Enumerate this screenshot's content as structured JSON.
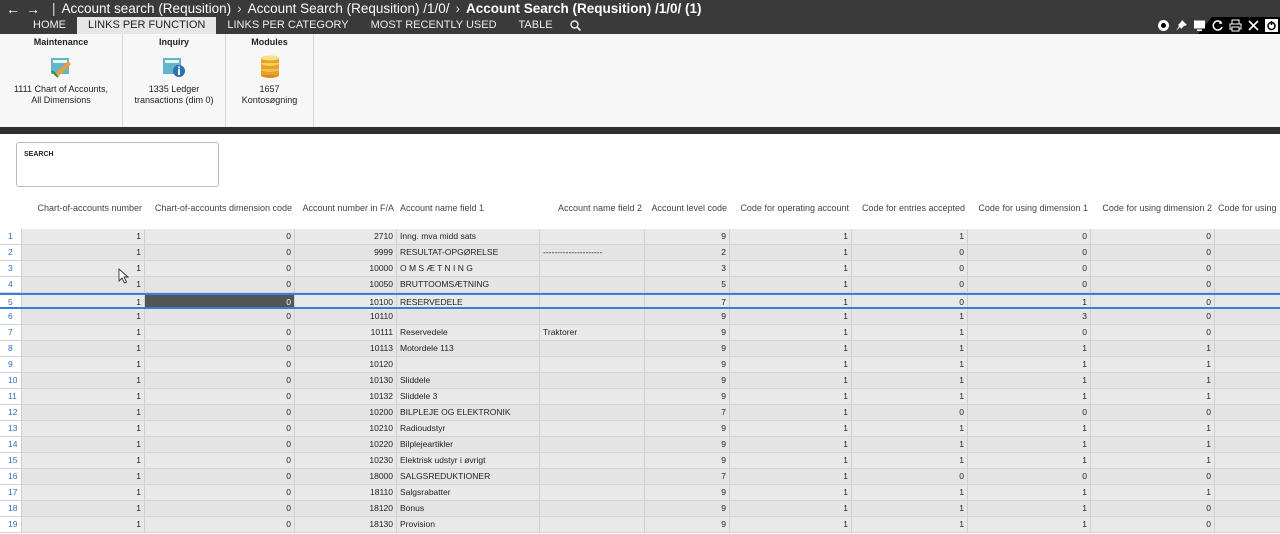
{
  "breadcrumb": {
    "back": "←",
    "forward": "→",
    "items": [
      "Account search (Requsition)",
      "Account Search (Requsition) /1/0/"
    ],
    "current": "Account Search (Requsition) /1/0/ (1)"
  },
  "tabs": [
    "HOME",
    "LINKS PER FUNCTION",
    "LINKS PER CATEGORY",
    "MOST RECENTLY USED",
    "TABLE"
  ],
  "active_tab": "LINKS PER FUNCTION",
  "toolbar_icons": [
    "help-icon",
    "pin-icon",
    "screen-icon",
    "refresh-icon",
    "print-icon",
    "close-icon",
    "power-icon"
  ],
  "ribbon": [
    {
      "title": "Maintenance",
      "label_line1": "1111 Chart of Accounts,",
      "label_line2": "All Dimensions",
      "icon": "maintenance-icon"
    },
    {
      "title": "Inquiry",
      "label_line1": "1335 Ledger",
      "label_line2": "transactions (dim 0)",
      "icon": "inquiry-icon"
    },
    {
      "title": "Modules",
      "label_line1": "1657",
      "label_line2": "Kontosøgning",
      "icon": "coins-icon"
    }
  ],
  "search": {
    "title": "SEARCH"
  },
  "columns": [
    "Chart-of-accounts number",
    "Chart-of-accounts dimension code",
    "Account number in F/A",
    "Account name field 1",
    "Account name field 2",
    "Account level code",
    "Code for operating account",
    "Code for entries accepted",
    "Code for using dimension 1",
    "Code for using dimension 2",
    "Code for using"
  ],
  "rows": [
    {
      "n": "1",
      "c": [
        "1",
        "0",
        "2710",
        "Inng. mva midd sats",
        "",
        "9",
        "1",
        "1",
        "0",
        "0"
      ]
    },
    {
      "n": "2",
      "c": [
        "1",
        "0",
        "9999",
        "RESULTAT-OPGØRELSE",
        "---------------------",
        "2",
        "1",
        "0",
        "0",
        "0"
      ]
    },
    {
      "n": "3",
      "c": [
        "1",
        "0",
        "10000",
        "O M S Æ T N I N G",
        "",
        "3",
        "1",
        "0",
        "0",
        "0"
      ]
    },
    {
      "n": "4",
      "c": [
        "1",
        "0",
        "10050",
        "BRUTTOOMSÆTNING",
        "",
        "5",
        "1",
        "0",
        "0",
        "0"
      ]
    },
    {
      "n": "5",
      "c": [
        "1",
        "0",
        "10100",
        "RESERVEDELE",
        "",
        "7",
        "1",
        "0",
        "1",
        "0"
      ]
    },
    {
      "n": "6",
      "c": [
        "1",
        "0",
        "10110",
        "",
        "",
        "9",
        "1",
        "1",
        "3",
        "0"
      ]
    },
    {
      "n": "7",
      "c": [
        "1",
        "0",
        "10111",
        "Reservedele",
        "Traktorer",
        "9",
        "1",
        "1",
        "0",
        "0"
      ]
    },
    {
      "n": "8",
      "c": [
        "1",
        "0",
        "10113",
        "Motordele 113",
        "",
        "9",
        "1",
        "1",
        "1",
        "1"
      ]
    },
    {
      "n": "9",
      "c": [
        "1",
        "0",
        "10120",
        "",
        "",
        "9",
        "1",
        "1",
        "1",
        "1"
      ]
    },
    {
      "n": "10",
      "c": [
        "1",
        "0",
        "10130",
        "Sliddele",
        "",
        "9",
        "1",
        "1",
        "1",
        "1"
      ]
    },
    {
      "n": "11",
      "c": [
        "1",
        "0",
        "10132",
        "Sliddele 3",
        "",
        "9",
        "1",
        "1",
        "1",
        "1"
      ]
    },
    {
      "n": "12",
      "c": [
        "1",
        "0",
        "10200",
        "BILPLEJE OG ELEKTRONIK",
        "",
        "7",
        "1",
        "0",
        "0",
        "0"
      ]
    },
    {
      "n": "13",
      "c": [
        "1",
        "0",
        "10210",
        "Radioudstyr",
        "",
        "9",
        "1",
        "1",
        "1",
        "1"
      ]
    },
    {
      "n": "14",
      "c": [
        "1",
        "0",
        "10220",
        "Bilplejeartikler",
        "",
        "9",
        "1",
        "1",
        "1",
        "1"
      ]
    },
    {
      "n": "15",
      "c": [
        "1",
        "0",
        "10230",
        "Elektrisk udstyr i øvrigt",
        "",
        "9",
        "1",
        "1",
        "1",
        "1"
      ]
    },
    {
      "n": "16",
      "c": [
        "1",
        "0",
        "18000",
        "SALGSREDUKTIONER",
        "",
        "7",
        "1",
        "0",
        "0",
        "0"
      ]
    },
    {
      "n": "17",
      "c": [
        "1",
        "0",
        "18110",
        "Salgsrabatter",
        "",
        "9",
        "1",
        "1",
        "1",
        "1"
      ]
    },
    {
      "n": "18",
      "c": [
        "1",
        "0",
        "18120",
        "Bonus",
        "",
        "9",
        "1",
        "1",
        "1",
        "0"
      ]
    },
    {
      "n": "19",
      "c": [
        "1",
        "0",
        "18130",
        "Provision",
        "",
        "9",
        "1",
        "1",
        "1",
        "0"
      ]
    }
  ],
  "selected_row": "5",
  "colors": {
    "accent": "#3c7ed6",
    "topbar": "#3a3a3a",
    "row_link": "#2a6fc9"
  }
}
